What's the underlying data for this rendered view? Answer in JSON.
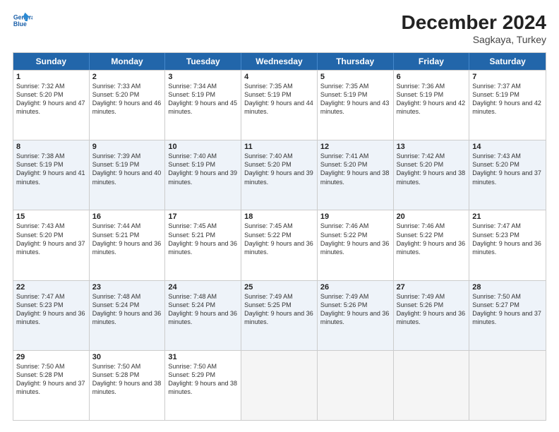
{
  "logo": {
    "line1": "General",
    "line2": "Blue"
  },
  "title": "December 2024",
  "subtitle": "Sagkaya, Turkey",
  "days": [
    "Sunday",
    "Monday",
    "Tuesday",
    "Wednesday",
    "Thursday",
    "Friday",
    "Saturday"
  ],
  "rows": [
    [
      {
        "day": "1",
        "sunrise": "Sunrise: 7:32 AM",
        "sunset": "Sunset: 5:20 PM",
        "daylight": "Daylight: 9 hours and 47 minutes."
      },
      {
        "day": "2",
        "sunrise": "Sunrise: 7:33 AM",
        "sunset": "Sunset: 5:20 PM",
        "daylight": "Daylight: 9 hours and 46 minutes."
      },
      {
        "day": "3",
        "sunrise": "Sunrise: 7:34 AM",
        "sunset": "Sunset: 5:19 PM",
        "daylight": "Daylight: 9 hours and 45 minutes."
      },
      {
        "day": "4",
        "sunrise": "Sunrise: 7:35 AM",
        "sunset": "Sunset: 5:19 PM",
        "daylight": "Daylight: 9 hours and 44 minutes."
      },
      {
        "day": "5",
        "sunrise": "Sunrise: 7:35 AM",
        "sunset": "Sunset: 5:19 PM",
        "daylight": "Daylight: 9 hours and 43 minutes."
      },
      {
        "day": "6",
        "sunrise": "Sunrise: 7:36 AM",
        "sunset": "Sunset: 5:19 PM",
        "daylight": "Daylight: 9 hours and 42 minutes."
      },
      {
        "day": "7",
        "sunrise": "Sunrise: 7:37 AM",
        "sunset": "Sunset: 5:19 PM",
        "daylight": "Daylight: 9 hours and 42 minutes."
      }
    ],
    [
      {
        "day": "8",
        "sunrise": "Sunrise: 7:38 AM",
        "sunset": "Sunset: 5:19 PM",
        "daylight": "Daylight: 9 hours and 41 minutes."
      },
      {
        "day": "9",
        "sunrise": "Sunrise: 7:39 AM",
        "sunset": "Sunset: 5:19 PM",
        "daylight": "Daylight: 9 hours and 40 minutes."
      },
      {
        "day": "10",
        "sunrise": "Sunrise: 7:40 AM",
        "sunset": "Sunset: 5:19 PM",
        "daylight": "Daylight: 9 hours and 39 minutes."
      },
      {
        "day": "11",
        "sunrise": "Sunrise: 7:40 AM",
        "sunset": "Sunset: 5:20 PM",
        "daylight": "Daylight: 9 hours and 39 minutes."
      },
      {
        "day": "12",
        "sunrise": "Sunrise: 7:41 AM",
        "sunset": "Sunset: 5:20 PM",
        "daylight": "Daylight: 9 hours and 38 minutes."
      },
      {
        "day": "13",
        "sunrise": "Sunrise: 7:42 AM",
        "sunset": "Sunset: 5:20 PM",
        "daylight": "Daylight: 9 hours and 38 minutes."
      },
      {
        "day": "14",
        "sunrise": "Sunrise: 7:43 AM",
        "sunset": "Sunset: 5:20 PM",
        "daylight": "Daylight: 9 hours and 37 minutes."
      }
    ],
    [
      {
        "day": "15",
        "sunrise": "Sunrise: 7:43 AM",
        "sunset": "Sunset: 5:20 PM",
        "daylight": "Daylight: 9 hours and 37 minutes."
      },
      {
        "day": "16",
        "sunrise": "Sunrise: 7:44 AM",
        "sunset": "Sunset: 5:21 PM",
        "daylight": "Daylight: 9 hours and 36 minutes."
      },
      {
        "day": "17",
        "sunrise": "Sunrise: 7:45 AM",
        "sunset": "Sunset: 5:21 PM",
        "daylight": "Daylight: 9 hours and 36 minutes."
      },
      {
        "day": "18",
        "sunrise": "Sunrise: 7:45 AM",
        "sunset": "Sunset: 5:22 PM",
        "daylight": "Daylight: 9 hours and 36 minutes."
      },
      {
        "day": "19",
        "sunrise": "Sunrise: 7:46 AM",
        "sunset": "Sunset: 5:22 PM",
        "daylight": "Daylight: 9 hours and 36 minutes."
      },
      {
        "day": "20",
        "sunrise": "Sunrise: 7:46 AM",
        "sunset": "Sunset: 5:22 PM",
        "daylight": "Daylight: 9 hours and 36 minutes."
      },
      {
        "day": "21",
        "sunrise": "Sunrise: 7:47 AM",
        "sunset": "Sunset: 5:23 PM",
        "daylight": "Daylight: 9 hours and 36 minutes."
      }
    ],
    [
      {
        "day": "22",
        "sunrise": "Sunrise: 7:47 AM",
        "sunset": "Sunset: 5:23 PM",
        "daylight": "Daylight: 9 hours and 36 minutes."
      },
      {
        "day": "23",
        "sunrise": "Sunrise: 7:48 AM",
        "sunset": "Sunset: 5:24 PM",
        "daylight": "Daylight: 9 hours and 36 minutes."
      },
      {
        "day": "24",
        "sunrise": "Sunrise: 7:48 AM",
        "sunset": "Sunset: 5:24 PM",
        "daylight": "Daylight: 9 hours and 36 minutes."
      },
      {
        "day": "25",
        "sunrise": "Sunrise: 7:49 AM",
        "sunset": "Sunset: 5:25 PM",
        "daylight": "Daylight: 9 hours and 36 minutes."
      },
      {
        "day": "26",
        "sunrise": "Sunrise: 7:49 AM",
        "sunset": "Sunset: 5:26 PM",
        "daylight": "Daylight: 9 hours and 36 minutes."
      },
      {
        "day": "27",
        "sunrise": "Sunrise: 7:49 AM",
        "sunset": "Sunset: 5:26 PM",
        "daylight": "Daylight: 9 hours and 36 minutes."
      },
      {
        "day": "28",
        "sunrise": "Sunrise: 7:50 AM",
        "sunset": "Sunset: 5:27 PM",
        "daylight": "Daylight: 9 hours and 37 minutes."
      }
    ],
    [
      {
        "day": "29",
        "sunrise": "Sunrise: 7:50 AM",
        "sunset": "Sunset: 5:28 PM",
        "daylight": "Daylight: 9 hours and 37 minutes."
      },
      {
        "day": "30",
        "sunrise": "Sunrise: 7:50 AM",
        "sunset": "Sunset: 5:28 PM",
        "daylight": "Daylight: 9 hours and 38 minutes."
      },
      {
        "day": "31",
        "sunrise": "Sunrise: 7:50 AM",
        "sunset": "Sunset: 5:29 PM",
        "daylight": "Daylight: 9 hours and 38 minutes."
      },
      null,
      null,
      null,
      null
    ]
  ]
}
